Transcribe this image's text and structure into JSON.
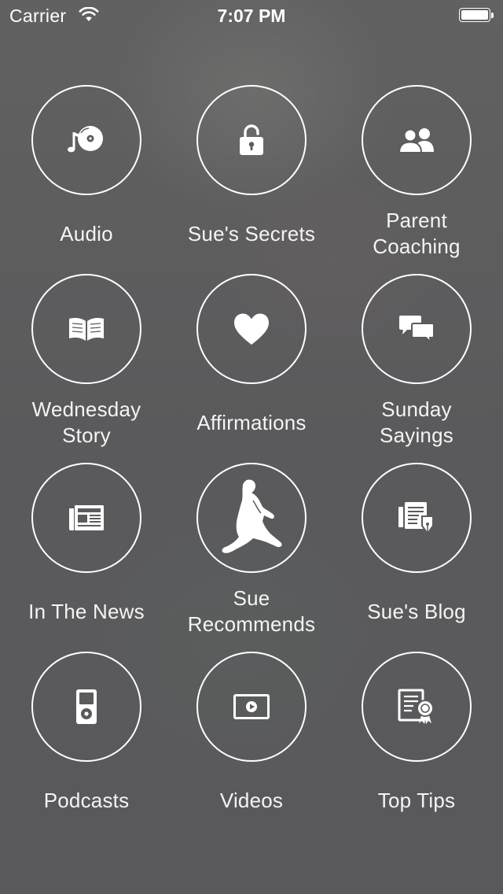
{
  "status_bar": {
    "carrier": "Carrier",
    "time": "7:07 PM",
    "battery_level": 1.0
  },
  "menu": {
    "items": [
      {
        "label": "Audio",
        "icon": "music-disc-icon"
      },
      {
        "label": "Sue's Secrets",
        "icon": "unlock-icon"
      },
      {
        "label": "Parent\nCoaching",
        "icon": "users-icon"
      },
      {
        "label": "Wednesday\nStory",
        "icon": "open-book-icon"
      },
      {
        "label": "Affirmations",
        "icon": "heart-icon"
      },
      {
        "label": "Sunday\nSayings",
        "icon": "speech-bubbles-icon"
      },
      {
        "label": "In The News",
        "icon": "newspaper-icon"
      },
      {
        "label": "Sue\nRecommends",
        "icon": "seated-woman-silhouette-icon"
      },
      {
        "label": "Sue's Blog",
        "icon": "blog-pen-icon"
      },
      {
        "label": "Podcasts",
        "icon": "ipod-icon"
      },
      {
        "label": "Videos",
        "icon": "video-play-icon"
      },
      {
        "label": "Top Tips",
        "icon": "certificate-icon"
      }
    ]
  },
  "colors": {
    "background": "#5b5b5d",
    "foreground": "#ffffff"
  }
}
